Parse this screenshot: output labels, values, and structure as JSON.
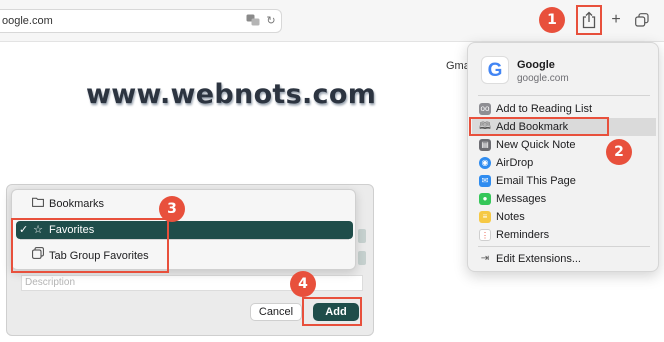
{
  "browser": {
    "address_text": "oogle.com",
    "toolbar_icons": [
      "translate-icon",
      "reload-icon",
      "share-icon",
      "plus-icon",
      "tabs-overview-icon"
    ]
  },
  "page": {
    "watermark": "www.webnots.com",
    "partial_link": "Gma"
  },
  "share_menu": {
    "site_name": "Google",
    "site_url": "google.com",
    "logo_letter": "G",
    "items": [
      {
        "label": "Add to Reading List",
        "icon": "glasses-icon",
        "color": "#8e8e93"
      },
      {
        "label": "Add Bookmark",
        "icon": "book-icon",
        "color": "#ffffff"
      },
      {
        "label": "New Quick Note",
        "icon": "quick-note-icon",
        "color": "#6d6d72"
      },
      {
        "label": "AirDrop",
        "icon": "airdrop-icon",
        "color": "#2f8cf0"
      },
      {
        "label": "Email This Page",
        "icon": "mail-icon",
        "color": "#2f8cf0"
      },
      {
        "label": "Messages",
        "icon": "messages-icon",
        "color": "#35c759"
      },
      {
        "label": "Notes",
        "icon": "notes-icon",
        "color": "#f6c945"
      },
      {
        "label": "Reminders",
        "icon": "reminders-icon",
        "color": "#ffffff"
      },
      {
        "label": "Edit Extensions...",
        "icon": "extensions-icon",
        "color": "#6d6d72"
      }
    ]
  },
  "folder_dropdown": {
    "items": [
      {
        "label": "Bookmarks",
        "icon": "folder-icon",
        "checked": false
      },
      {
        "label": "Favorites",
        "icon": "star-icon",
        "checked": true
      },
      {
        "label": "Tab Group Favorites",
        "icon": "tab-group-icon",
        "checked": false
      }
    ],
    "check_mark": "✓"
  },
  "bookmark_dialog": {
    "description_placeholder": "Description",
    "cancel_label": "Cancel",
    "add_label": "Add"
  },
  "steps": [
    "1",
    "2",
    "3",
    "4"
  ],
  "colors": {
    "highlight": "#e8503c",
    "accent": "#1f4d4a"
  }
}
